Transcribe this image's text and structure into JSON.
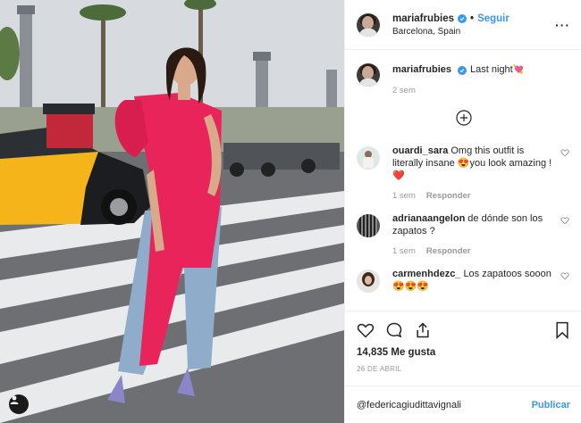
{
  "post": {
    "username": "mariafrubies",
    "follow_label": "Seguir",
    "separator": "•",
    "location": "Barcelona, Spain",
    "more_icon": "more-options-icon"
  },
  "caption": {
    "username": "mariafrubies",
    "text": "Last night",
    "emoji": "💘",
    "time": "2 sem"
  },
  "comments": [
    {
      "username": "ouardi_sara",
      "text": "Omg this outfit is literally insane 😍you look amazing ! ❤️",
      "time": "1 sem",
      "reply_label": "Responder"
    },
    {
      "username": "adrianaangelon",
      "text": "de dónde son los zapatos ?",
      "time": "1 sem",
      "reply_label": "Responder"
    },
    {
      "username": "carmenhdezc_",
      "text": "Los zapatoos sooon 😍😍😍",
      "time": "",
      "reply_label": ""
    }
  ],
  "actions": {
    "likes": "14,835 Me gusta",
    "date": "26 DE ABRIL",
    "icons": [
      "heart-icon",
      "comment-icon",
      "share-icon",
      "bookmark-icon"
    ]
  },
  "add_comment": {
    "value": "@federicagiudittavignali",
    "publish_label": "Publicar"
  },
  "colors": {
    "accent": "#3897f0",
    "text": "#262626",
    "muted": "#999999",
    "border": "#efefef",
    "dress": "#e8245a"
  }
}
